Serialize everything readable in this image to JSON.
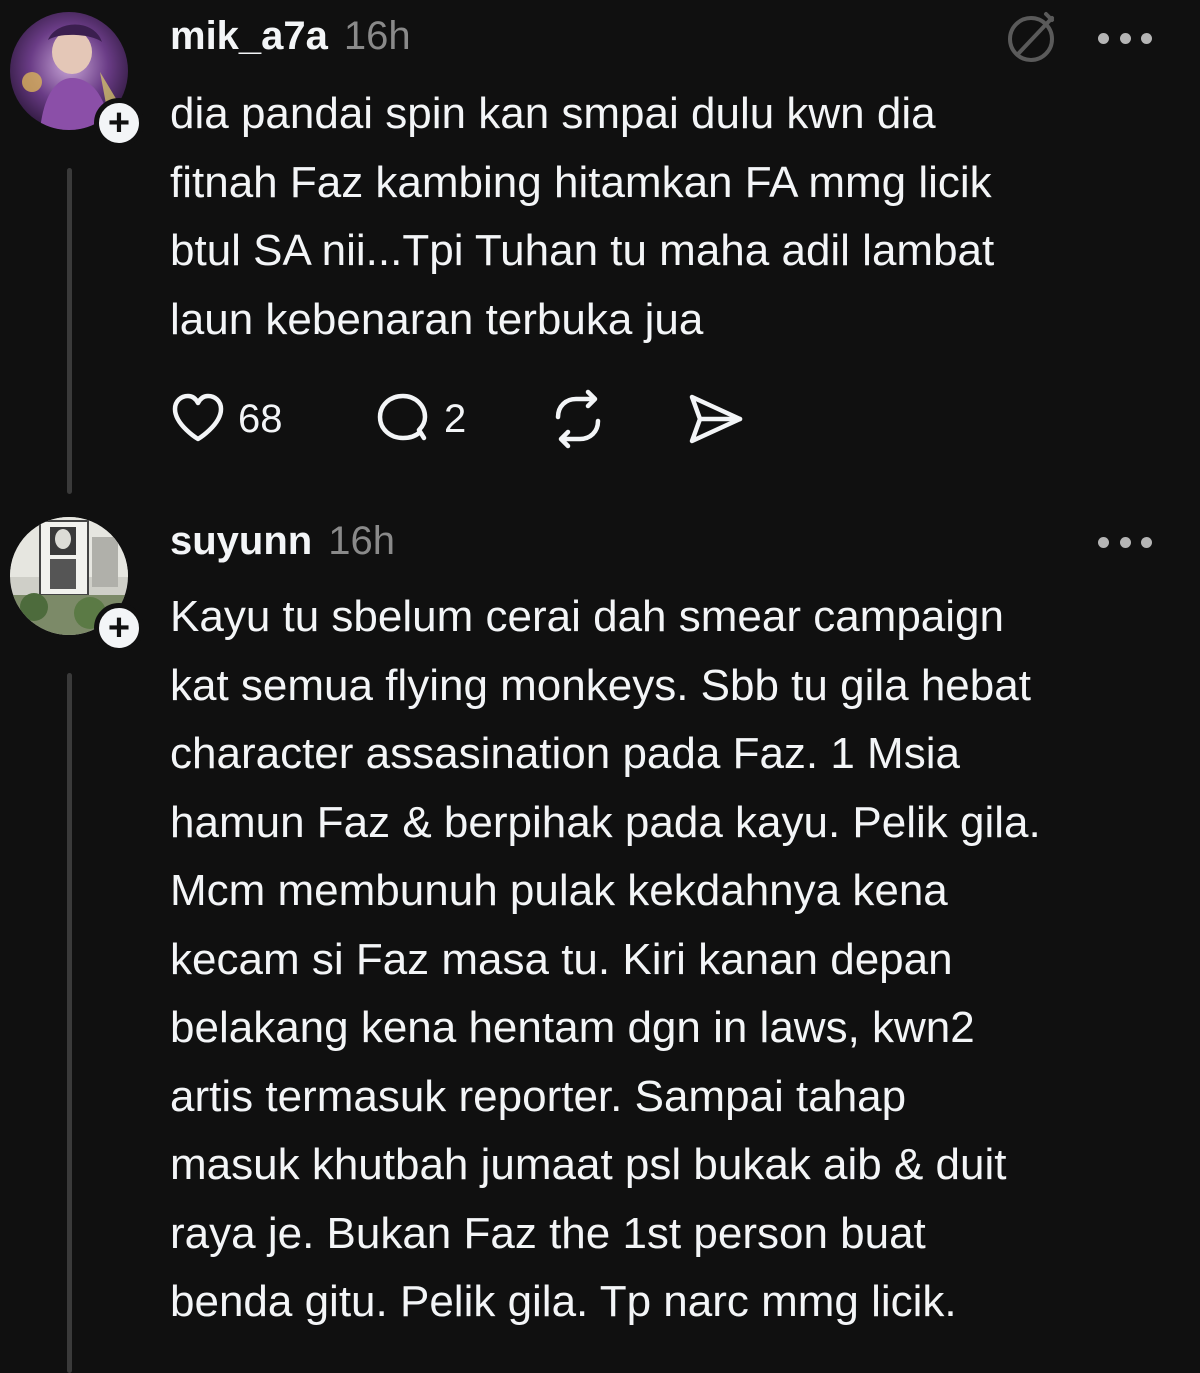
{
  "posts": [
    {
      "username": "mik_a7a",
      "time": "16h",
      "text": "dia pandai spin kan smpai dulu kwn dia\nfitnah Faz kambing hitamkan FA mmg licik\nbtul SA nii...Tpi Tuhan tu maha adil lambat\nlaun kebenaran terbuka jua",
      "likes": "68",
      "replies": "2",
      "follow_symbol": "+"
    },
    {
      "username": "suyunn",
      "time": "16h",
      "text": "Kayu tu sbelum cerai dah smear campaign\nkat semua flying monkeys. Sbb tu gila hebat\ncharacter assasination pada Faz. 1 Msia\nhamun Faz & berpihak pada kayu. Pelik gila.\nMcm membunuh pulak kekdahnya kena\nkecam si Faz masa tu. Kiri kanan depan\nbelakang kena hentam dgn in laws, kwn2\nartis termasuk reporter. Sampai tahap\nmasuk khutbah jumaat psl bukak aib & duit\nraya je. Bukan Faz the 1st person buat\nbenda gitu. Pelik gila. Tp narc mmg licik.",
      "follow_symbol": "+"
    }
  ],
  "icons": {
    "translate": "translate-icon",
    "more": "more-options-icon",
    "like": "heart-icon",
    "reply": "comment-icon",
    "repost": "repost-icon",
    "share": "send-icon"
  },
  "colors": {
    "background": "#101010",
    "text": "#f3f5f7",
    "secondary": "#8a8a8a",
    "thread_line": "#3a3a3a"
  }
}
